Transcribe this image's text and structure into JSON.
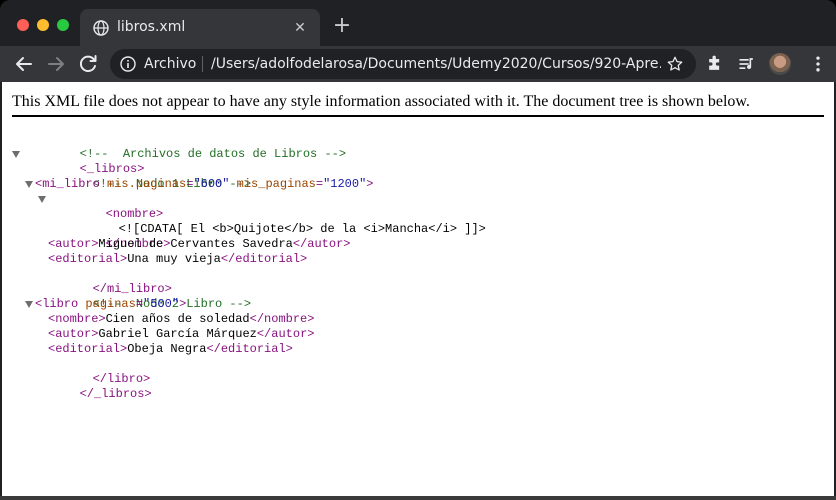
{
  "browser": {
    "tab_title": "libros.xml",
    "tab_close": "✕",
    "new_tab": "+",
    "omnibox_chip": "Archivo",
    "url": "/Users/adolfodelarosa/Documents/Udemy2020/Cursos/920-Apre…"
  },
  "page": {
    "notice": "This XML file does not appear to have any style information associated with it. The document tree is shown below."
  },
  "xml": {
    "l1_comment": "<!--  Archivos de datos de Libros -->",
    "l2_open": "<_libros>",
    "l3_comment": "<!--  Nodo 1 Libro -->",
    "l4_tag_open": "<mi_libro ",
    "l4_attr1": "mis.paginas",
    "l4_eq1": "=",
    "l4_val1": "\"600\"",
    "l4_sp": " ",
    "l4_attr2": "mis_paginas",
    "l4_eq2": "=",
    "l4_val2": "\"1200\"",
    "l4_tag_close": ">",
    "l5_open": "<nombre>",
    "l6_cdata": "<![CDATA[ El <b>Quijote</b> de la <i>Mancha</i> ]]>",
    "l7_close": "</nombre>",
    "l8_open": "<autor>",
    "l8_text": "Miguel de Cervantes Savedra",
    "l8_close": "</autor>",
    "l9_open": "<editorial>",
    "l9_text": "Una muy vieja",
    "l9_close": "</editorial>",
    "l10_close": "</mi_libro>",
    "l11_comment": "<!--  Nodo 2 Libro -->",
    "l12_tag_open": "<libro ",
    "l12_attr": "paginas",
    "l12_eq": "=",
    "l12_val": "\"500\"",
    "l12_tag_close": ">",
    "l13_open": "<nombre>",
    "l13_text": "Cien años de soledad",
    "l13_close": "</nombre>",
    "l14_open": "<autor>",
    "l14_text": "Gabriel García Márquez",
    "l14_close": "</autor>",
    "l15_open": "<editorial>",
    "l15_text": "Obeja Negra",
    "l15_close": "</editorial>",
    "l16_close": "</libro>",
    "l17_close": "</_libros>"
  },
  "colors": {
    "comment": "#236e25",
    "tag": "#881280",
    "attr_name": "#994500",
    "attr_value": "#1a1aa6",
    "chrome_dark": "#202124",
    "chrome_tab": "#35363a"
  },
  "icons": [
    "globe-icon",
    "back-arrow-icon",
    "forward-arrow-icon",
    "reload-icon",
    "info-icon",
    "star-icon",
    "puzzle-icon",
    "media-queue-icon",
    "avatar",
    "kebab-menu-icon"
  ]
}
